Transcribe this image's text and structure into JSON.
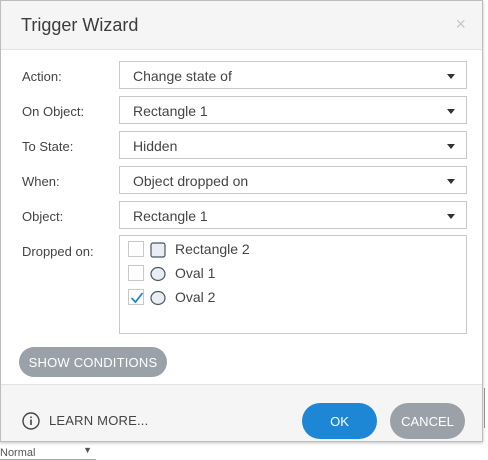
{
  "dialog": {
    "title": "Trigger Wizard",
    "close_glyph": "×"
  },
  "fields": [
    {
      "label": "Action:",
      "value": "Change state of"
    },
    {
      "label": "On Object:",
      "value": "Rectangle 1"
    },
    {
      "label": "To State:",
      "value": "Hidden"
    },
    {
      "label": "When:",
      "value": "Object dropped on"
    },
    {
      "label": "Object:",
      "value": "Rectangle 1"
    }
  ],
  "dropped_on": {
    "label": "Dropped on:",
    "items": [
      {
        "label": "Rectangle 2",
        "checked": false,
        "icon": "rectangle-shape-icon"
      },
      {
        "label": "Oval 1",
        "checked": false,
        "icon": "oval-shape-icon"
      },
      {
        "label": "Oval 2",
        "checked": true,
        "icon": "oval-shape-icon"
      }
    ]
  },
  "show_conditions_label": "SHOW CONDITIONS",
  "footer": {
    "learn_more_label": "LEARN MORE...",
    "ok_label": "OK",
    "cancel_label": "CANCEL"
  },
  "background": {
    "select_value": "Normal"
  },
  "colors": {
    "primary": "#1d87d6",
    "secondary_button": "#9aa1a8",
    "checkmark": "#1d87d6"
  }
}
